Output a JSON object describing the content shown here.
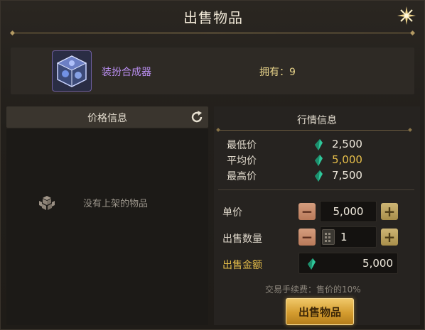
{
  "dialog": {
    "title": "出售物品"
  },
  "item": {
    "name": "装扮合成器",
    "owned_label": "拥有：",
    "owned_count": "9"
  },
  "price_panel": {
    "header": "价格信息",
    "empty_text": "没有上架的物品"
  },
  "market": {
    "header": "行情信息",
    "stats": [
      {
        "label": "最低价",
        "value": "2,500",
        "color": "#efe9dd"
      },
      {
        "label": "平均价",
        "value": "5,000",
        "color": "#e7bf4a"
      },
      {
        "label": "最高价",
        "value": "7,500",
        "color": "#efe9dd"
      }
    ]
  },
  "form": {
    "unit_price_label": "单价",
    "unit_price_value": "5,000",
    "quantity_label": "出售数量",
    "quantity_value": "1",
    "total_label": "出售金额",
    "total_value": "5,000",
    "fee_note": "交易手续费：售价的10%"
  },
  "actions": {
    "sell_label": "出售物品"
  },
  "colors": {
    "accent_gold": "#e7bf4a",
    "item_name": "#b98ef0",
    "gem": "#2fc79a"
  }
}
